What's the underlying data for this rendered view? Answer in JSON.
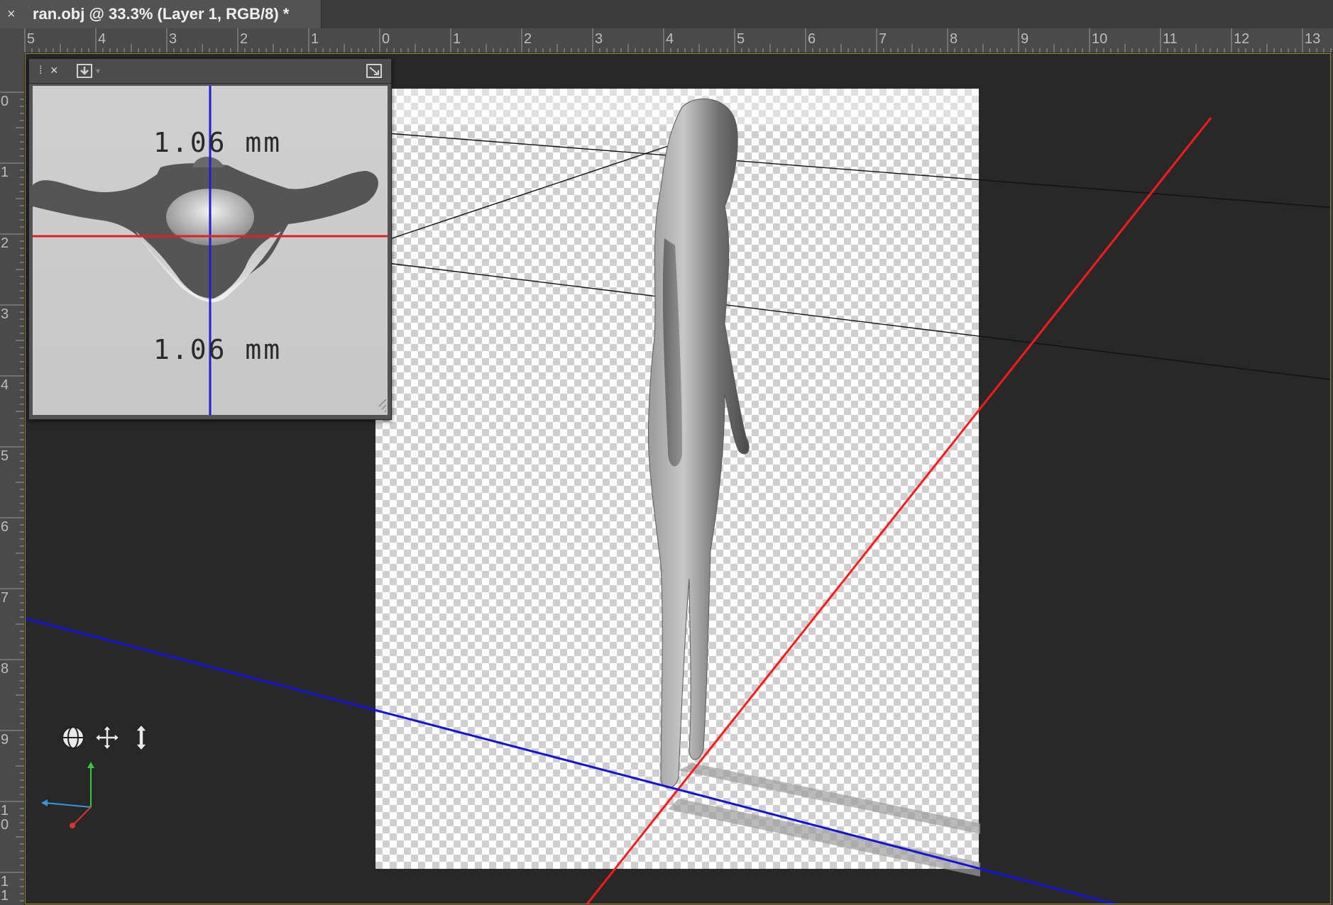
{
  "document": {
    "tab_title": "ran.obj @ 33.3% (Layer 1, RGB/8) *",
    "close_symbol": "×"
  },
  "rulers": {
    "top": [
      "5",
      "4",
      "3",
      "2",
      "1",
      "0",
      "1",
      "2",
      "3",
      "4",
      "5",
      "6",
      "7",
      "8",
      "9",
      "10",
      "11",
      "12",
      "13"
    ],
    "left": [
      "0",
      "1",
      "2",
      "3",
      "4",
      "5",
      "6",
      "7",
      "8",
      "9",
      "1\n0",
      "1\n1"
    ]
  },
  "preview_panel": {
    "grip_symbol": "⁞",
    "close_symbol": "×",
    "dim_top": "1.06 mm",
    "dim_bottom": "1.06 mm",
    "icons": [
      "panel-grip-icon",
      "close-icon",
      "save-view-icon",
      "dropdown-icon",
      "expand-icon"
    ]
  },
  "nav_tools": {
    "icons": [
      "orbit-icon",
      "pan-icon",
      "dolly-icon"
    ]
  },
  "axis_widget": {
    "colors": {
      "x": "#d33",
      "y": "#3c3",
      "z": "#39d"
    }
  },
  "colors": {
    "canvas_bg": "#282828",
    "x_axis_line": "#ff1a1a",
    "z_axis_line": "#1414d9",
    "panel_v_line": "#1f1fd0",
    "panel_h_line": "#e02020"
  }
}
